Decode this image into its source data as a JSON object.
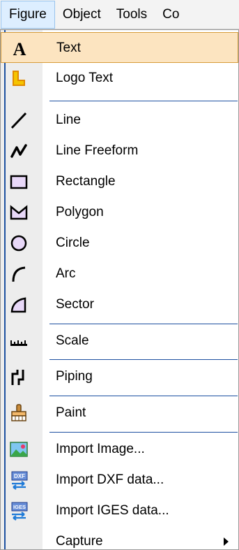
{
  "menubar": {
    "items": [
      {
        "label": "Figure"
      },
      {
        "label": "Object"
      },
      {
        "label": "Tools"
      },
      {
        "label": "Co"
      }
    ]
  },
  "menu": {
    "items": [
      {
        "label": "Text",
        "icon": "text-icon"
      },
      {
        "label": "Logo Text",
        "icon": "logo-text-icon"
      },
      {
        "label": "Line",
        "icon": "line-icon"
      },
      {
        "label": "Line Freeform",
        "icon": "line-freeform-icon"
      },
      {
        "label": "Rectangle",
        "icon": "rectangle-icon"
      },
      {
        "label": "Polygon",
        "icon": "polygon-icon"
      },
      {
        "label": "Circle",
        "icon": "circle-icon"
      },
      {
        "label": "Arc",
        "icon": "arc-icon"
      },
      {
        "label": "Sector",
        "icon": "sector-icon"
      },
      {
        "label": "Scale",
        "icon": "scale-icon"
      },
      {
        "label": "Piping",
        "icon": "piping-icon"
      },
      {
        "label": "Paint",
        "icon": "paint-icon"
      },
      {
        "label": "Import Image...",
        "icon": "import-image-icon"
      },
      {
        "label": "Import DXF data...",
        "icon": "import-dxf-icon"
      },
      {
        "label": "Import IGES data...",
        "icon": "import-iges-icon"
      },
      {
        "label": "Capture",
        "icon": "",
        "has_submenu": true
      }
    ],
    "highlighted_item": "Text"
  },
  "colors": {
    "highlight_bg": "#fce4c0",
    "highlight_border": "#d79c3a",
    "separator": "#1c50a0",
    "active_menubar_bg": "#ddeeff",
    "icon_fill": "#e8d8f8"
  },
  "icons": {
    "dxf_badge": "DXF",
    "iges_badge": "IGES"
  }
}
